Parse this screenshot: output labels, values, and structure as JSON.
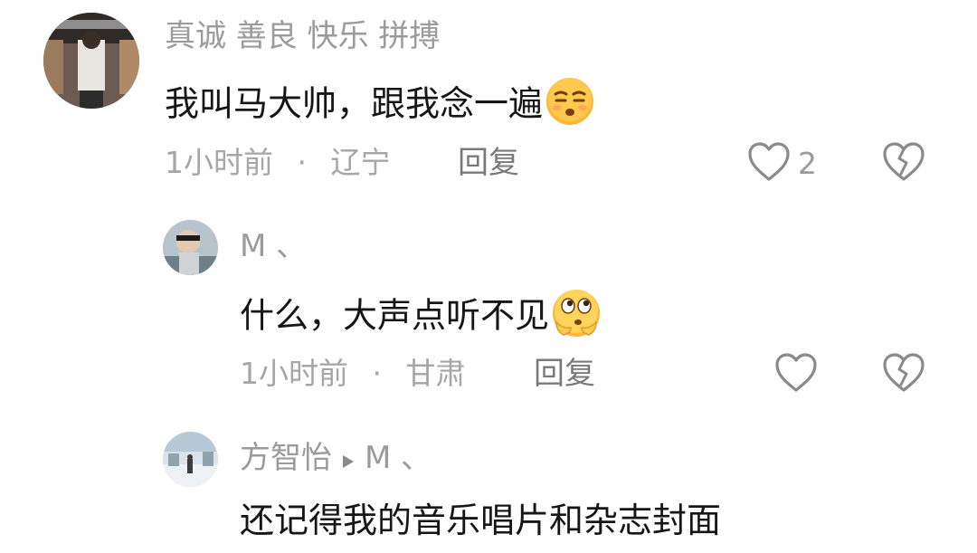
{
  "comments": [
    {
      "username": "真诚  善良  快乐  拼搏",
      "text": "我叫马大帅，跟我念一遍",
      "emoji": "face-emoji-unamused",
      "time": "1小时前",
      "separator": "·",
      "location": "辽宁",
      "reply_label": "回复",
      "likes": "2"
    },
    {
      "username": "M 、",
      "text": "什么，大声点听不见",
      "emoji": "face-emoji-thinking-eyes",
      "time": "1小时前",
      "separator": "·",
      "location": "甘肃",
      "reply_label": "回复",
      "likes": ""
    },
    {
      "username": "方智怡",
      "reply_to": "M 、",
      "text": "还记得我的音乐唱片和杂志封面"
    }
  ],
  "colors": {
    "username": "#9b9b9b",
    "body_text": "#161616",
    "meta": "#a6a6a6",
    "icon": "#8a8a8a"
  }
}
